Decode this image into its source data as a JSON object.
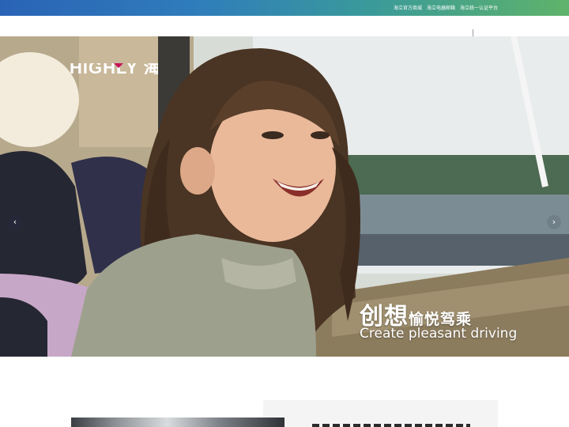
{
  "top_links": [
    "海立官方商城",
    "海立电器邮箱",
    "海立统一认证平台"
  ],
  "logo": {
    "text": "HIGHLY 海立"
  },
  "hero": {
    "slogan_cn_big": "创想",
    "slogan_cn_small": "愉悦驾乘",
    "slogan_en": "Create pleasant driving",
    "prev_icon": "‹",
    "next_icon": "›"
  },
  "colors": {
    "topbar_start": "#2a63b6",
    "topbar_end": "#5fb36a",
    "logo_accent": "#c4145a"
  }
}
